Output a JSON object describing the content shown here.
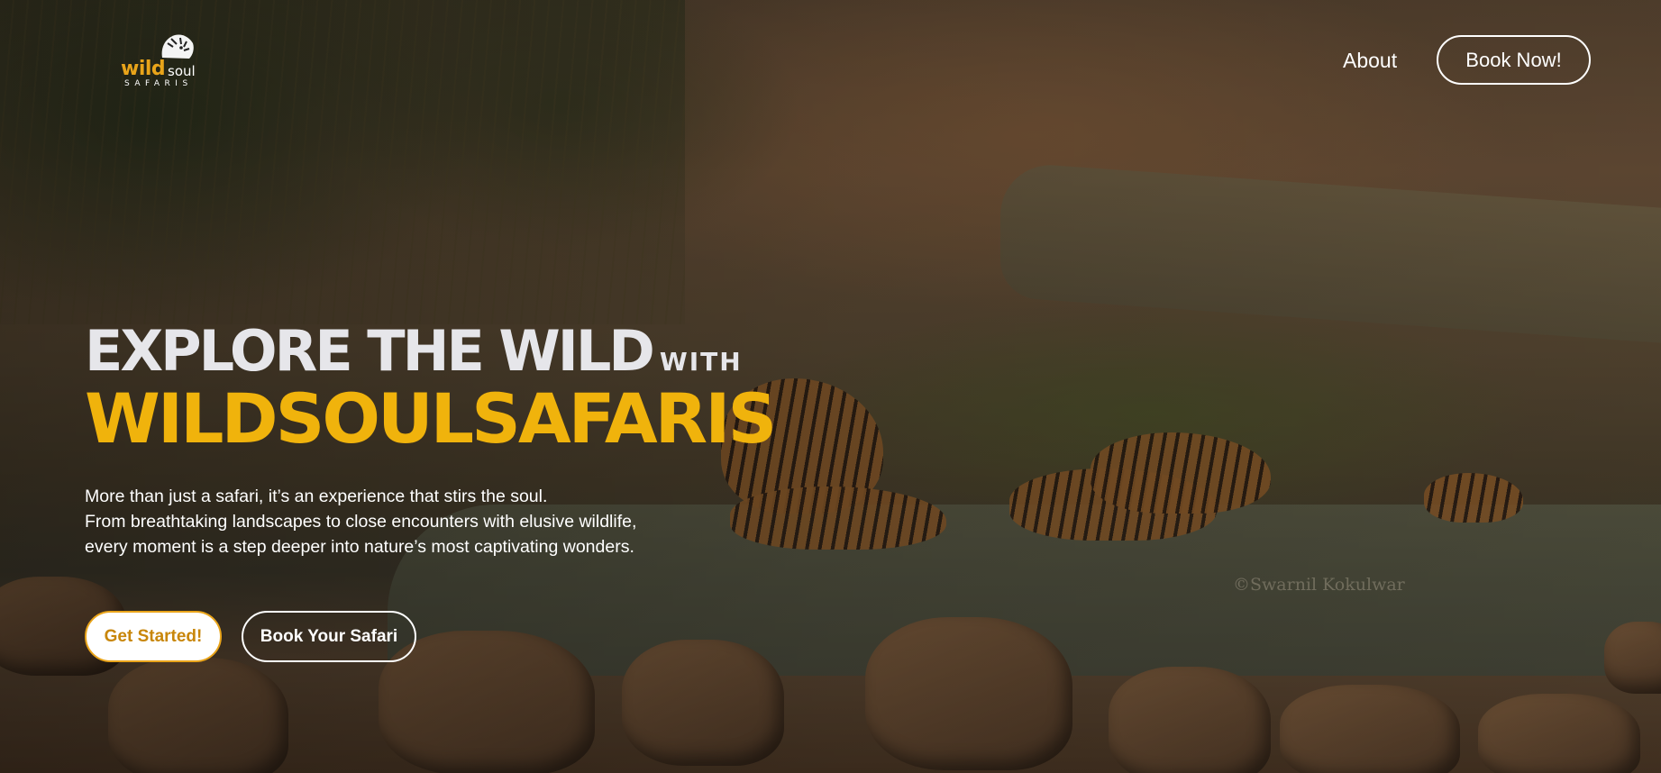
{
  "header": {
    "logo": {
      "wild": "wild",
      "soul": "soul",
      "safaris": "SAFARIS"
    },
    "nav": {
      "about_label": "About",
      "book_label": "Book Now!"
    }
  },
  "hero": {
    "headline_main": "EXPLORE THE WILD",
    "headline_with": "WITH",
    "headline_brand": "WILDSOULSAFARIS",
    "description_lines": [
      "More than just a safari, it’s an experience that stirs the soul.",
      "From breathtaking landscapes to close encounters with elusive wildlife,",
      "every moment is a step deeper into nature’s most captivating wonders."
    ],
    "cta_primary": "Get Started!",
    "cta_secondary": "Book Your Safari",
    "photo_credit": "©Swarnil Kokulwar"
  },
  "colors": {
    "accent": "#f0b30c",
    "headline_white": "#e6e6ea",
    "button_text_accent": "#c8860a"
  }
}
